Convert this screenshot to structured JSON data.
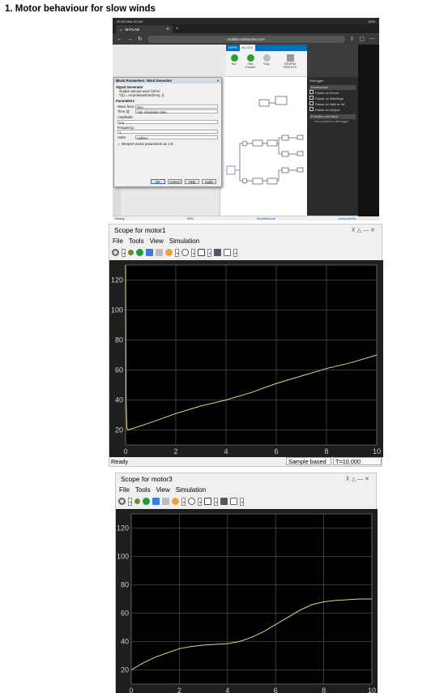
{
  "doc": {
    "heading": "1.   Motor behaviour for slow winds"
  },
  "ipad": {
    "time": "20:33  Wed 20 Oct",
    "battery": "83%",
    "tab_label": "MATLAB",
    "new_tab": "+",
    "url": "matlab.mathworks.com",
    "toolstrip_tabs": [
      "APPS",
      "BLOCK"
    ],
    "tools": [
      "Run",
      "Step Forward",
      "Stop",
      "REVIEW RESULTS"
    ],
    "debugger": {
      "title": "Debugger",
      "breakpoints_header": "Breakpoints",
      "options": [
        "Pause on Errors",
        "Pause on Warnings",
        "Pause on NaN or Inf",
        "Pause on Output"
      ],
      "call_stack_header": "Function call stack",
      "call_stack_text": "Not paused in debugger"
    },
    "status": {
      "ready": "Ready",
      "zoom": "94%",
      "link": "SlowNetwork",
      "solver": "auto(ode45)"
    },
    "dialog": {
      "title": "Block Parameters: Wind Generator",
      "block_name": "Signal Generator",
      "desc1": "Output various wave forms:",
      "desc2": "Y(t) = Amp*Waveform(Freq, t)",
      "params_header": "Parameters",
      "wave_label": "Wave form:",
      "wave_value": "sine",
      "time_label": "Time (t):",
      "time_value": "Use simulation time",
      "amp_label": "Amplitude:",
      "amp_value": "0.5",
      "freq_label": "Frequency:",
      "freq_value": "1",
      "units_label": "Units:",
      "units_value": "rad/sec",
      "interpret": "Interpret vector parameters as 1-D",
      "ok": "OK",
      "cancel": "Cancel",
      "help": "Help",
      "apply": "Apply"
    }
  },
  "scopes": [
    {
      "title": "Scope for motor1",
      "menu": [
        "File",
        "Tools",
        "View",
        "Simulation"
      ],
      "status_ready": "Ready",
      "status_mode": "Sample based",
      "status_time": "T=10.000",
      "chart_data": {
        "type": "line",
        "title": "",
        "xlabel": "",
        "ylabel": "",
        "xlim": [
          0,
          10
        ],
        "ylim": [
          10,
          130
        ],
        "x_ticks": [
          "0",
          "2",
          "4",
          "6",
          "8",
          "10"
        ],
        "y_ticks": [
          "20",
          "40",
          "60",
          "80",
          "100",
          "120"
        ],
        "grid": true,
        "line_color": "#e8d87c",
        "series": [
          {
            "x": [
              0,
              0.02,
              0.05,
              0.1,
              1,
              2,
              3,
              4,
              5,
              6,
              7,
              8,
              9,
              10
            ],
            "y": [
              130,
              40,
              21,
              20,
              25,
              31,
              36,
              40,
              45,
              51,
              56,
              61,
              65,
              70
            ]
          }
        ]
      }
    },
    {
      "title": "Scope for motor3",
      "menu": [
        "File",
        "Tools",
        "View",
        "Simulation"
      ],
      "chart_data": {
        "type": "line",
        "title": "",
        "xlabel": "",
        "ylabel": "",
        "xlim": [
          0,
          10
        ],
        "ylim": [
          10,
          130
        ],
        "x_ticks": [
          "0",
          "2",
          "4",
          "6",
          "8",
          "10"
        ],
        "y_ticks": [
          "20",
          "40",
          "60",
          "80",
          "100",
          "120"
        ],
        "grid": true,
        "line_color": "#e8d87c",
        "series": [
          {
            "x": [
              0,
              0.5,
              1,
              1.5,
              2,
              2.5,
              3,
              3.5,
              4,
              4.5,
              5,
              5.5,
              6,
              6.5,
              7,
              7.5,
              8,
              8.5,
              9,
              9.5,
              10
            ],
            "y": [
              20,
              25,
              29,
              32,
              35,
              36.5,
              37.5,
              38,
              38.5,
              40,
              43,
              47,
              52,
              57,
              62,
              66,
              68,
              69,
              69.5,
              70,
              70
            ]
          }
        ]
      }
    }
  ]
}
